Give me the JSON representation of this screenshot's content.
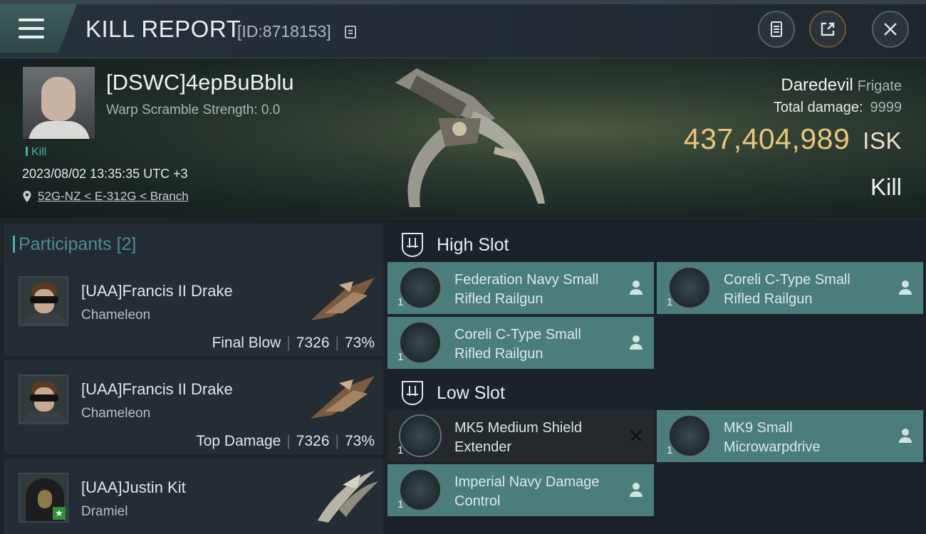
{
  "header": {
    "title": "KILL REPORT",
    "report_id": "[ID:8718153]"
  },
  "victim": {
    "name": "[DSWC]4epBuBblu",
    "warp_scramble": "Warp Scramble Strength: 0.0",
    "kill_tag": "Kill",
    "datetime": "2023/08/02 13:35:35 UTC +3",
    "location": "52G-NZ < E-312G < Branch",
    "ship_name": "Daredevil",
    "ship_class": "Frigate",
    "total_damage_label": "Total damage:",
    "total_damage_value": "9999",
    "isk_value": "437,404,989",
    "isk_unit": "ISK",
    "result": "Kill"
  },
  "participants": {
    "label": "Participants",
    "count": "[2]",
    "items": [
      {
        "name": "[UAA]Francis II Drake",
        "ship": "Chameleon",
        "role": "Final Blow",
        "damage": "7326",
        "percent": "73%"
      },
      {
        "name": "[UAA]Francis II Drake",
        "ship": "Chameleon",
        "role": "Top Damage",
        "damage": "7326",
        "percent": "73%"
      },
      {
        "name": "[UAA]Justin Kit",
        "ship": "Dramiel"
      }
    ]
  },
  "fitting": {
    "high_slot_label": "High Slot",
    "low_slot_label": "Low Slot",
    "high": [
      {
        "name": "Federation Navy Small Rifled Railgun",
        "qty": "1",
        "state": "dropped"
      },
      {
        "name": "Coreli C-Type Small Rifled Railgun",
        "qty": "1",
        "state": "dropped"
      },
      {
        "name": "Coreli C-Type Small Rifled Railgun",
        "qty": "1",
        "state": "dropped"
      }
    ],
    "low": [
      {
        "name": "MK5 Medium Shield Extender",
        "qty": "1",
        "state": "destroyed"
      },
      {
        "name": "MK9 Small Microwarpdrive",
        "qty": "1",
        "state": "dropped"
      },
      {
        "name": "Imperial Navy Damage Control",
        "qty": "1",
        "state": "dropped"
      }
    ]
  },
  "colors": {
    "accent_teal": "#4b7e7b",
    "isk_gold": "#e8c77b",
    "background": "#1b2126"
  },
  "icons": [
    "menu-icon",
    "copy-icon",
    "notes-icon",
    "share-icon",
    "close-icon",
    "pin-icon",
    "slot-icon",
    "person-icon",
    "cross-icon"
  ]
}
